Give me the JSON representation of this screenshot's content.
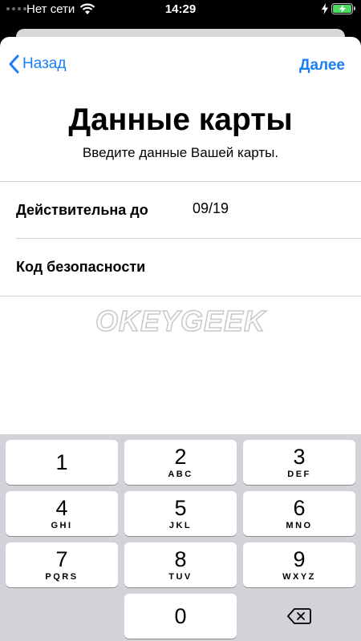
{
  "status_bar": {
    "carrier": "Нет сети",
    "time": "14:29"
  },
  "nav": {
    "back_label": "Назад",
    "next_label": "Далее"
  },
  "header": {
    "title": "Данные карты",
    "subtitle": "Введите данные Вашей карты."
  },
  "form": {
    "expiry_label": "Действительна до",
    "expiry_value": "09/19",
    "security_label": "Код безопасности",
    "security_value": ""
  },
  "watermark": "OKEYGEEK",
  "keyboard": {
    "keys": [
      {
        "num": "1",
        "letters": ""
      },
      {
        "num": "2",
        "letters": "ABC"
      },
      {
        "num": "3",
        "letters": "DEF"
      },
      {
        "num": "4",
        "letters": "GHI"
      },
      {
        "num": "5",
        "letters": "JKL"
      },
      {
        "num": "6",
        "letters": "MNO"
      },
      {
        "num": "7",
        "letters": "PQRS"
      },
      {
        "num": "8",
        "letters": "TUV"
      },
      {
        "num": "9",
        "letters": "WXYZ"
      },
      {
        "num": "0",
        "letters": ""
      }
    ]
  },
  "colors": {
    "accent": "#1a7ff5",
    "battery": "#4cd964",
    "keyboard_bg": "#d1d3d9"
  },
  "icons": {
    "wifi": "wifi-icon",
    "battery": "battery-icon",
    "back": "chevron-left-icon",
    "delete": "backspace-icon"
  }
}
